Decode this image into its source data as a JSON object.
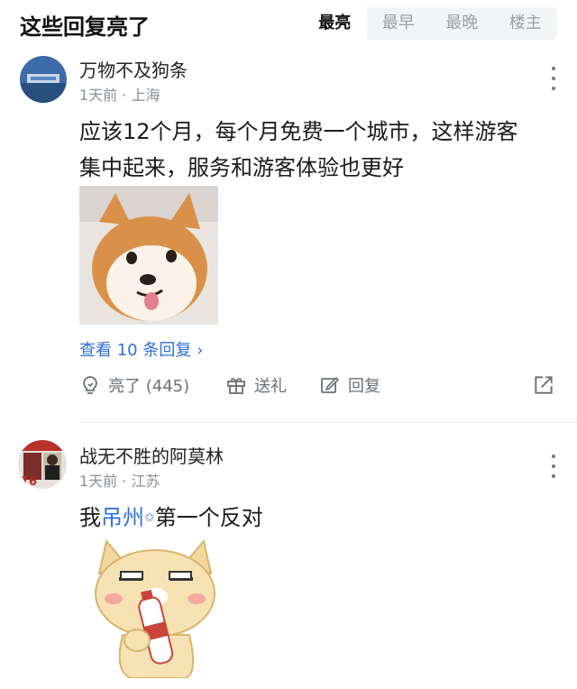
{
  "header": {
    "title": "这些回复亮了",
    "sort_tabs": [
      {
        "label": "最亮",
        "active": true
      },
      {
        "label": "最早",
        "active": false
      },
      {
        "label": "最晚",
        "active": false
      },
      {
        "label": "楼主",
        "active": false
      }
    ]
  },
  "comments": [
    {
      "username": "万物不及狗条",
      "time": "1天前",
      "location": "上海",
      "text_line1": "应该12个月，每个月免费一个城市，这样游客",
      "text_line2": "集中起来，服务和游客体验也更好",
      "image": "shiba-dog-sticker",
      "replies_link": "查看 10 条回复 ›",
      "actions": {
        "light_label": "亮了 (445)",
        "gift_label": "送礼",
        "reply_label": "回复"
      }
    },
    {
      "username": "战无不胜的阿莫林",
      "time": "1天前",
      "location": "江苏",
      "text_prefix": "我",
      "text_link": "吊州",
      "text_suffix": "第一个反对",
      "image": "cartoon-dog-holding-bottle-sticker"
    }
  ],
  "colors": {
    "link": "#2f6fd8",
    "meta": "#8a8f96",
    "tab_bg": "#f3f4f6"
  }
}
